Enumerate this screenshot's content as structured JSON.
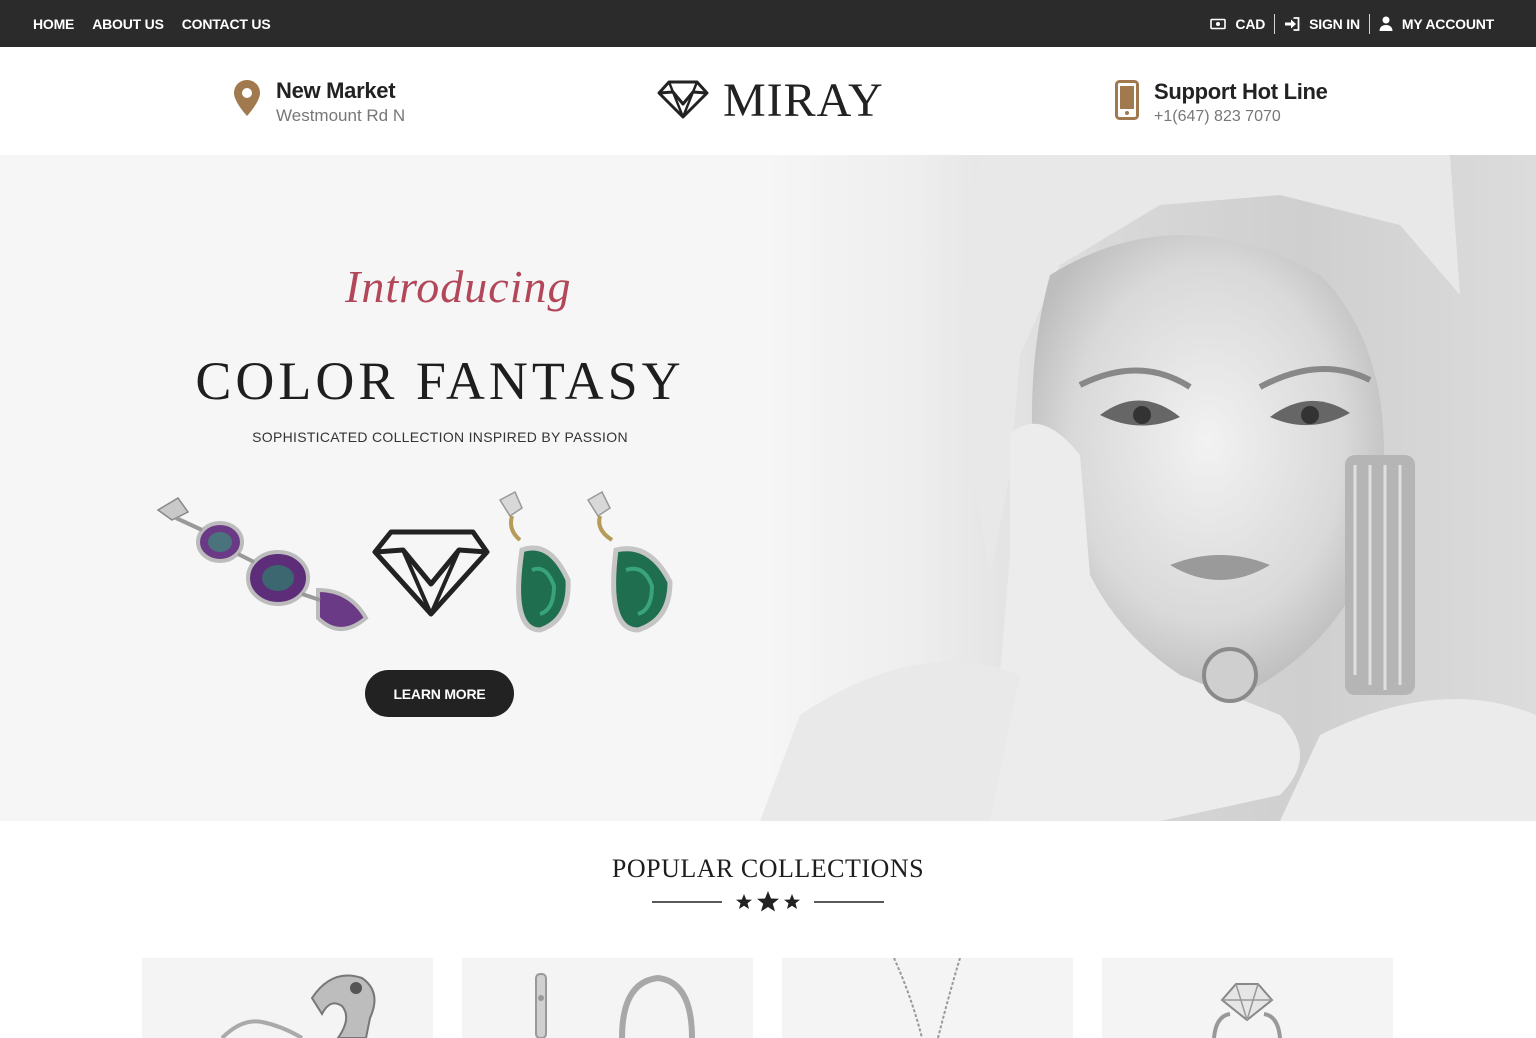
{
  "topbar": {
    "nav": [
      {
        "label": "HOME"
      },
      {
        "label": "ABOUT US"
      },
      {
        "label": "CONTACT US"
      }
    ],
    "currency_label": "CAD",
    "signin_label": "SIGN IN",
    "account_label": "MY ACCOUNT"
  },
  "header": {
    "location": {
      "title": "New Market",
      "subtitle": "Westmount Rd N",
      "icon": "map-pin-icon"
    },
    "logo": {
      "text": "MIRAY",
      "icon": "diamond-logo-icon"
    },
    "support": {
      "title": "Support Hot Line",
      "phone": "+1(647) 823 7070",
      "icon": "phone-icon"
    }
  },
  "hero": {
    "intro": "Introducing",
    "title": "COLOR FANTASY",
    "subtitle": "SOPHISTICATED COLLECTION INSPIRED BY PASSION",
    "button_label": "LEARN MORE"
  },
  "collections": {
    "title": "POPULAR COLLECTIONS",
    "cards": [
      {
        "name": "ring-product"
      },
      {
        "name": "earring-product"
      },
      {
        "name": "necklace-product"
      },
      {
        "name": "diamond-ring-product"
      }
    ]
  },
  "colors": {
    "topbar_bg": "#2b2b2b",
    "accent_gold": "#a07a4e",
    "intro_red": "#b3475a",
    "button_dark": "#222222"
  }
}
